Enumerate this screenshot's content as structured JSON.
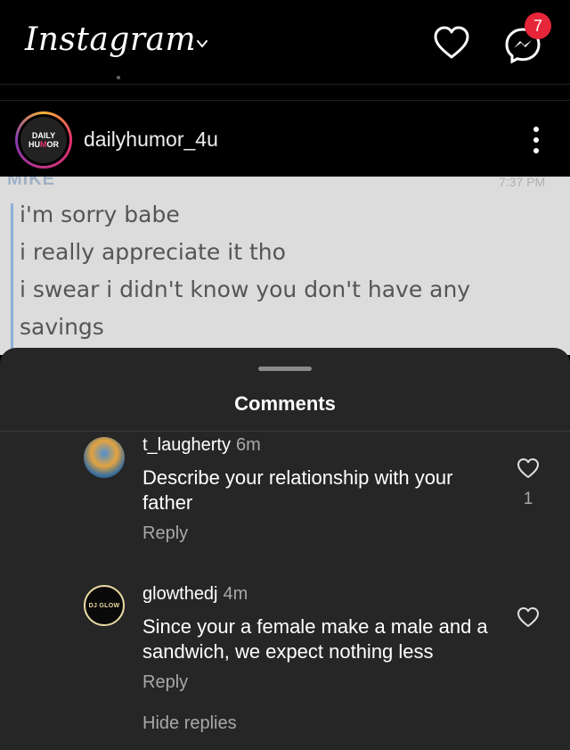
{
  "app": {
    "logo": "Instagram",
    "notification_count": "7"
  },
  "post": {
    "username": "dailyhumor_4u",
    "avatar_line1": "DAILY",
    "avatar_line2_a": "HU",
    "avatar_line2_o": "M",
    "avatar_line2_b": "OR",
    "image": {
      "sender": "MIKE",
      "time": "7:37 PM",
      "lines": [
        "i'm sorry babe",
        "i really appreciate it tho",
        "i swear i didn't know you don't have any",
        "savings"
      ]
    }
  },
  "comments_sheet": {
    "title": "Comments",
    "hide_replies": "Hide replies",
    "comments": [
      {
        "user": "t_laugherty",
        "time": "6m",
        "text": "Describe your relationship with your father",
        "reply_label": "Reply",
        "likes": "1"
      },
      {
        "user": "glowthedj",
        "time": "4m",
        "avatar_text": "DJ GLOW",
        "text": "Since your a female make a male and a sandwich, we expect nothing less",
        "reply_label": "Reply",
        "likes": ""
      }
    ]
  },
  "colors": {
    "background": "#000000",
    "sheet": "#262626",
    "badge": "#e8263a",
    "secondary_text": "#a8a8a8"
  },
  "icons": [
    "chevron-down-icon",
    "heart-icon",
    "messenger-icon",
    "more-vertical-icon"
  ]
}
